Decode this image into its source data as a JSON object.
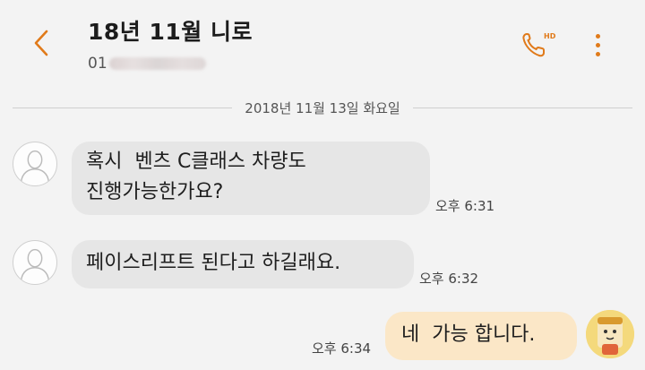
{
  "header": {
    "title": "18년 11월 니로",
    "phone_prefix": "01",
    "call_badge": "HD",
    "colors": {
      "accent": "#e07a1a"
    }
  },
  "date_separator": "2018년 11월 13일 화요일",
  "messages": [
    {
      "direction": "incoming",
      "lines": [
        "혹시  벤츠 C클래스 차량도",
        "진행가능한가요?"
      ],
      "time": "오후 6:31"
    },
    {
      "direction": "incoming",
      "lines": [
        "페이스리프트 된다고 하길래요."
      ],
      "time": "오후 6:32"
    },
    {
      "direction": "outgoing",
      "lines": [
        "네  가능 합니다."
      ],
      "time": "오후 6:34"
    }
  ]
}
